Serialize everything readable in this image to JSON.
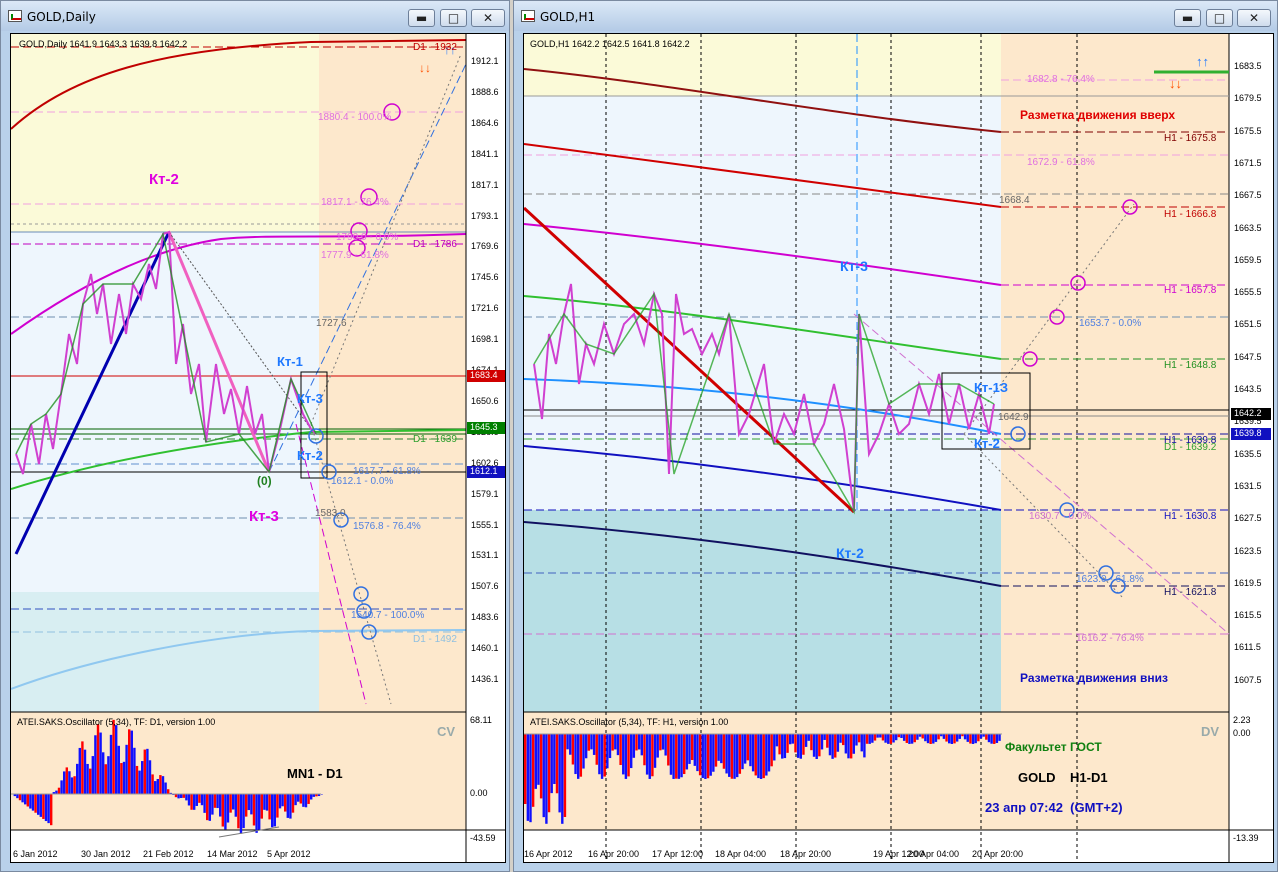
{
  "left": {
    "title": "GOLD,Daily",
    "ohlc": "GOLD,Daily  1641.9 1643.3 1639.8 1642.2",
    "yticks": [
      "1912.1",
      "1888.6",
      "1864.6",
      "1841.1",
      "1817.1",
      "1793.1",
      "1769.6",
      "1745.6",
      "1721.6",
      "1698.1",
      "1674.1",
      "1650.6",
      "1626.6",
      "1602.6",
      "1579.1",
      "1555.1",
      "1531.1",
      "1507.6",
      "1483.6",
      "1460.1",
      "1436.1"
    ],
    "price_tags": [
      {
        "text": "1683.4",
        "color": "#d00000"
      },
      {
        "text": "1645.3",
        "color": "#008000"
      },
      {
        "text": "1612.1",
        "color": "#1010c0"
      }
    ],
    "labels": {
      "kt2": "Кт-2",
      "kt1": "Кт-1",
      "kt3a": "Кт-3",
      "kt2b": "Кт-2",
      "kt3b": "Кт-3",
      "zero": "(0)"
    },
    "fibs": {
      "f1880": "1880.4 - 100.0%",
      "f1817": "1817.1 - 76.4%",
      "f1790": "1790.0 - 0.0%",
      "f1777": "1777.9 - 61.8%",
      "f1727": "1727.6",
      "f1617": "1617.7 - 61.8%",
      "f1612": "1612.1 - 0.0%",
      "f1583": "1583.0",
      "f1576": "1576.8 - 76.4%",
      "f1510": "1540.7 - 100.0%"
    },
    "levels": {
      "d1_1932": "D1 - 1932",
      "d1_1786": "D1 - 1786",
      "d1_1639": "D1 - 1639",
      "d1_1492": "D1 - 1492"
    },
    "osc_title": "ATEI.SAKS.Oscillator (5,34), TF: D1, version 1.00",
    "osc_tag": "CV",
    "osc_ticks": [
      "68.11",
      "0.00",
      "-43.59"
    ],
    "osc_label": "MN1 - D1",
    "xticks": [
      "6 Jan 2012",
      "30 Jan 2012",
      "21 Feb 2012",
      "14 Mar 2012",
      "5 Apr 2012"
    ]
  },
  "right": {
    "title": "GOLD,H1",
    "ohlc": "GOLD,H1  1642.2 1642.5 1641.8 1642.2",
    "yticks": [
      "1683.5",
      "1679.5",
      "1675.5",
      "1671.5",
      "1667.5",
      "1663.5",
      "1659.5",
      "1655.5",
      "1651.5",
      "1647.5",
      "1643.5",
      "1639.5",
      "1635.5",
      "1631.5",
      "1627.5",
      "1623.5",
      "1619.5",
      "1615.5",
      "1611.5",
      "1607.5"
    ],
    "price_tags": [
      {
        "text": "1642.2",
        "color": "#000000"
      },
      {
        "text": "1639.8",
        "color": "#1010c0"
      }
    ],
    "labels": {
      "up": "Разметка движения вверх",
      "down": "Разметка движения вниз",
      "kt3": "Кт-3",
      "kt2": "Кт-2",
      "kt13": "Кт-1З",
      "kt2b": "Кт-2"
    },
    "fibs": {
      "f1682": "1682.8 - 76.4%",
      "f1672": "1672.9 - 61.8%",
      "f1668": "1668.4",
      "f1653": "1653.7 - 0.0%",
      "f1642": "1642.9",
      "f1630": "1630.7 - 0.0%",
      "f1623": "1623.0 - 61.8%",
      "f1616": "1616.2 - 76.4%"
    },
    "levels": {
      "h1675": "H1 - 1675.8",
      "h1666": "H1 - 1666.8",
      "h1657": "H1 - 1657.8",
      "h1648": "H1 - 1648.8",
      "h1639": "H1 - 1639.8",
      "d1639": "D1 - 1639.2",
      "h1630": "H1 - 1630.8",
      "h1621": "H1 - 1621.8"
    },
    "osc_title": "ATEI.SAKS.Oscillator (5,34), TF: H1, version 1.00",
    "osc_tag": "DV",
    "osc_ticks": [
      "2.23",
      "0.00",
      "-13.39"
    ],
    "info": {
      "faculty": "Факультет ГОСТ",
      "pair": "GOLD    H1-D1",
      "time": "23 апр 07:42  (GMT+2)"
    },
    "xticks": [
      "16 Apr 2012",
      "16 Apr 20:00",
      "17 Apr 12:00",
      "18 Apr 04:00",
      "18 Apr 20:00",
      "19 Apr 12:00",
      "20 Apr 04:00",
      "20 Apr 20:00"
    ]
  }
}
